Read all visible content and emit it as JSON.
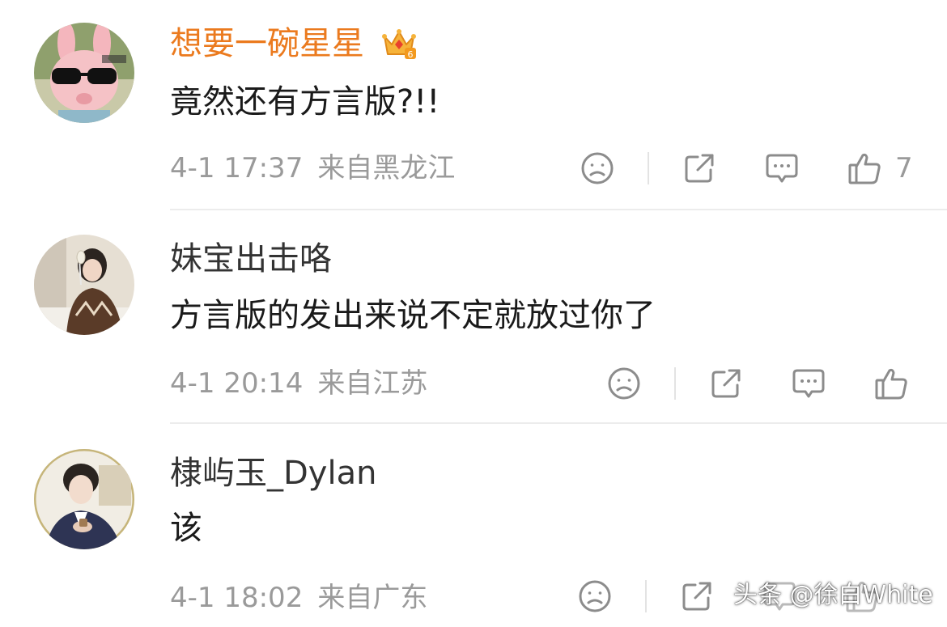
{
  "comments": [
    {
      "username": "想要一碗星星",
      "is_vip": true,
      "badge_icon": "crown-level-badge-icon",
      "text": "竟然还有方言版?!!",
      "time": "4-1 17:37",
      "location": "来自黑龙江",
      "like_count": "7",
      "avatar_desc": "cartoon-pig-sunglasses-avatar"
    },
    {
      "username": "妹宝出击咯",
      "is_vip": false,
      "text": "方言版的发出来说不定就放过你了",
      "time": "4-1 20:14",
      "location": "来自江苏",
      "like_count": "",
      "avatar_desc": "woman-photo-avatar"
    },
    {
      "username": "棣屿玉_Dylan",
      "is_vip": false,
      "text": "该",
      "time": "4-1 18:02",
      "location": "来自广东",
      "like_count": "",
      "avatar_desc": "man-in-suit-avatar"
    }
  ],
  "watermark": "头条 @徐白White",
  "colors": {
    "vip_name": "#eb7a1e",
    "name": "#333333",
    "text": "#1a1a1a",
    "meta": "#9a9a9a",
    "icon": "#8c8c8c",
    "divider": "#ececec"
  }
}
